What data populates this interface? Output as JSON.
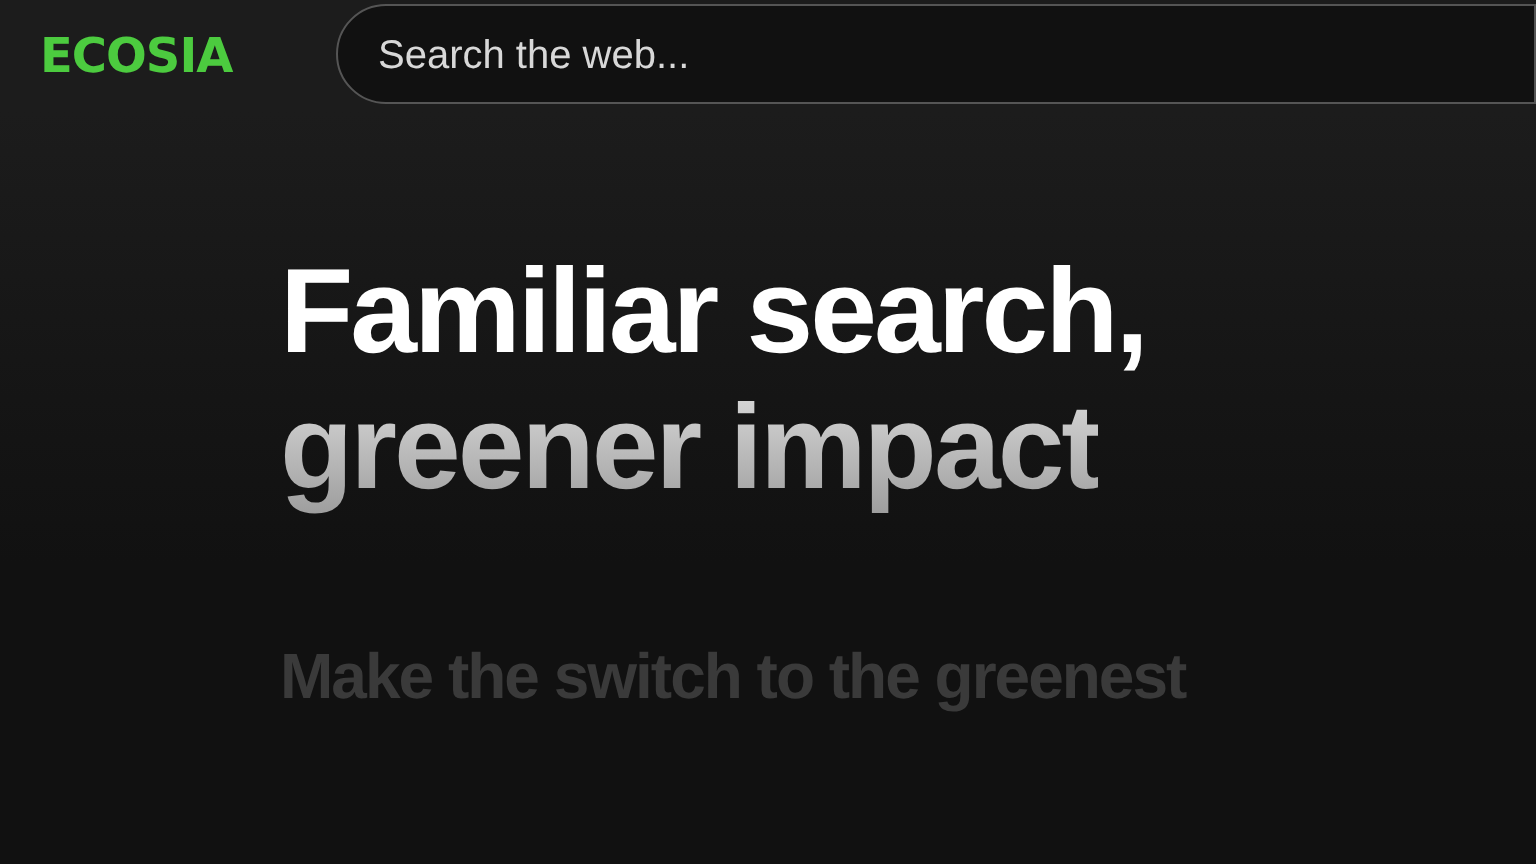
{
  "logo": "ECOSIA",
  "search": {
    "placeholder": "Search the web..."
  },
  "headline": [
    "Familiar search,",
    "greener impact"
  ],
  "subtitle": "Make the switch to the greenest"
}
